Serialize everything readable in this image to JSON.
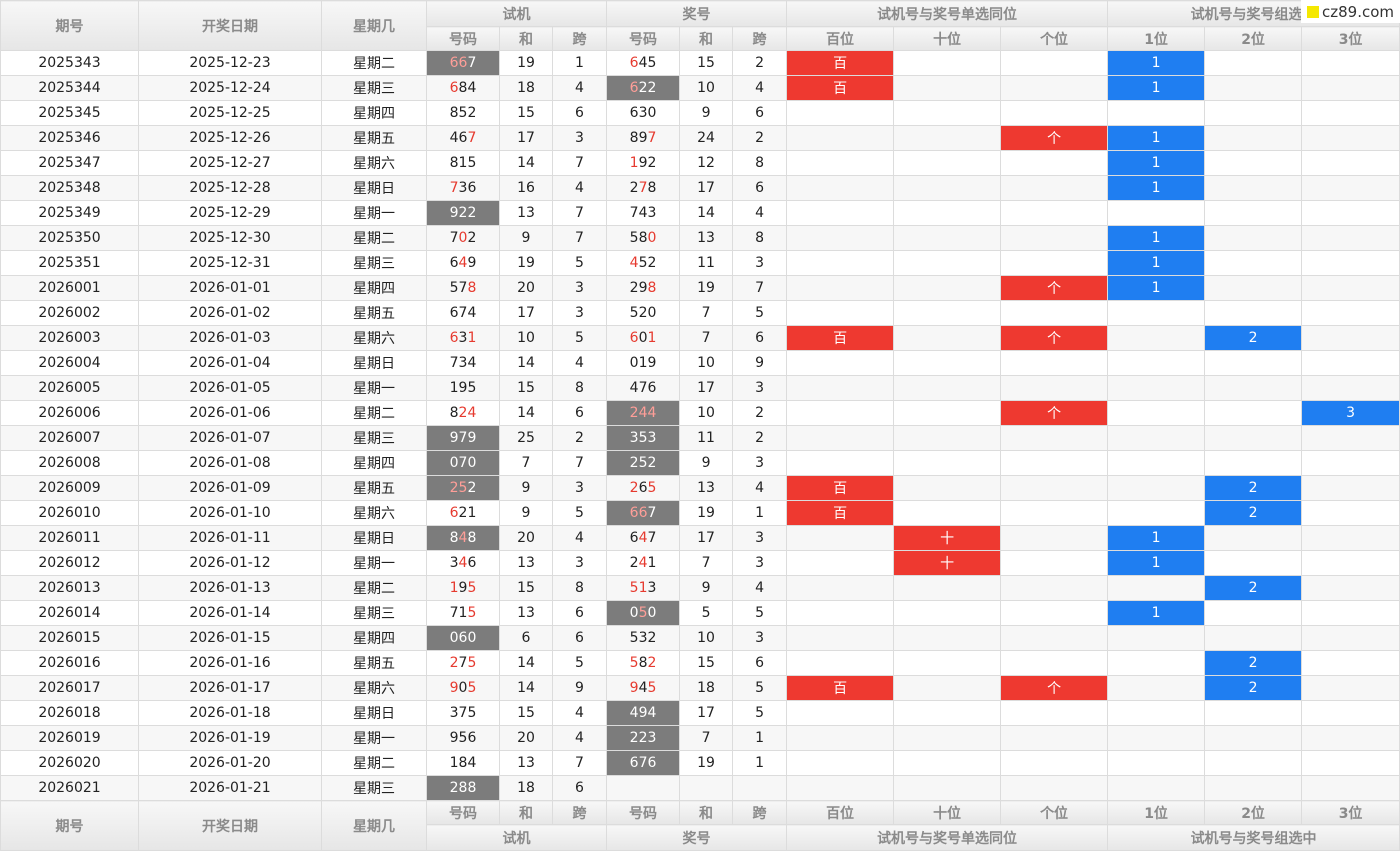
{
  "logo": {
    "text": "cz89.com",
    "icon": "yellow-square-icon"
  },
  "headers": {
    "period": "期号",
    "date": "开奖日期",
    "weekday": "星期几",
    "trial": "试机",
    "prize": "奖号",
    "single_same": "试机号与奖号单选同位",
    "group_same": "试机号与奖号组选中",
    "code": "号码",
    "sum": "和",
    "span": "跨",
    "bai": "百位",
    "shi": "十位",
    "ge": "个位",
    "pos1": "1位",
    "pos2": "2位",
    "pos3": "3位"
  },
  "colors": {
    "red_mark": "#ee3930",
    "blue_mark": "#1f7ef1",
    "dark_cell": "#7c7c7c",
    "digit_red": "#e63a2f"
  },
  "rows": [
    {
      "period": "2025343",
      "date": "2025-12-23",
      "weekday": "星期二",
      "trial": "667",
      "trial_hi": [
        0,
        1
      ],
      "trial_dark": true,
      "tsum": "19",
      "tspan": "1",
      "prize": "645",
      "prize_hi": [
        0
      ],
      "prize_dark": false,
      "psum": "15",
      "pspan": "2",
      "bai": "百",
      "shi": "",
      "ge": "",
      "p1": "1",
      "p2": "",
      "p3": ""
    },
    {
      "period": "2025344",
      "date": "2025-12-24",
      "weekday": "星期三",
      "trial": "684",
      "trial_hi": [
        0
      ],
      "trial_dark": false,
      "tsum": "18",
      "tspan": "4",
      "prize": "622",
      "prize_hi": [
        0
      ],
      "prize_dark": true,
      "psum": "10",
      "pspan": "4",
      "bai": "百",
      "shi": "",
      "ge": "",
      "p1": "1",
      "p2": "",
      "p3": ""
    },
    {
      "period": "2025345",
      "date": "2025-12-25",
      "weekday": "星期四",
      "trial": "852",
      "trial_hi": [],
      "trial_dark": false,
      "tsum": "15",
      "tspan": "6",
      "prize": "630",
      "prize_hi": [],
      "prize_dark": false,
      "psum": "9",
      "pspan": "6",
      "bai": "",
      "shi": "",
      "ge": "",
      "p1": "",
      "p2": "",
      "p3": ""
    },
    {
      "period": "2025346",
      "date": "2025-12-26",
      "weekday": "星期五",
      "trial": "467",
      "trial_hi": [
        2
      ],
      "trial_dark": false,
      "tsum": "17",
      "tspan": "3",
      "prize": "897",
      "prize_hi": [
        2
      ],
      "prize_dark": false,
      "psum": "24",
      "pspan": "2",
      "bai": "",
      "shi": "",
      "ge": "个",
      "p1": "1",
      "p2": "",
      "p3": ""
    },
    {
      "period": "2025347",
      "date": "2025-12-27",
      "weekday": "星期六",
      "trial": "815",
      "trial_hi": [],
      "trial_dark": false,
      "tsum": "14",
      "tspan": "7",
      "prize": "192",
      "prize_hi": [
        0
      ],
      "prize_dark": false,
      "psum": "12",
      "pspan": "8",
      "bai": "",
      "shi": "",
      "ge": "",
      "p1": "1",
      "p2": "",
      "p3": ""
    },
    {
      "period": "2025348",
      "date": "2025-12-28",
      "weekday": "星期日",
      "trial": "736",
      "trial_hi": [
        0
      ],
      "trial_dark": false,
      "tsum": "16",
      "tspan": "4",
      "prize": "278",
      "prize_hi": [
        1
      ],
      "prize_dark": false,
      "psum": "17",
      "pspan": "6",
      "bai": "",
      "shi": "",
      "ge": "",
      "p1": "1",
      "p2": "",
      "p3": ""
    },
    {
      "period": "2025349",
      "date": "2025-12-29",
      "weekday": "星期一",
      "trial": "922",
      "trial_hi": [],
      "trial_dark": true,
      "tsum": "13",
      "tspan": "7",
      "prize": "743",
      "prize_hi": [],
      "prize_dark": false,
      "psum": "14",
      "pspan": "4",
      "bai": "",
      "shi": "",
      "ge": "",
      "p1": "",
      "p2": "",
      "p3": ""
    },
    {
      "period": "2025350",
      "date": "2025-12-30",
      "weekday": "星期二",
      "trial": "702",
      "trial_hi": [
        1
      ],
      "trial_dark": false,
      "tsum": "9",
      "tspan": "7",
      "prize": "580",
      "prize_hi": [
        2
      ],
      "prize_dark": false,
      "psum": "13",
      "pspan": "8",
      "bai": "",
      "shi": "",
      "ge": "",
      "p1": "1",
      "p2": "",
      "p3": ""
    },
    {
      "period": "2025351",
      "date": "2025-12-31",
      "weekday": "星期三",
      "trial": "649",
      "trial_hi": [
        1
      ],
      "trial_dark": false,
      "tsum": "19",
      "tspan": "5",
      "prize": "452",
      "prize_hi": [
        0
      ],
      "prize_dark": false,
      "psum": "11",
      "pspan": "3",
      "bai": "",
      "shi": "",
      "ge": "",
      "p1": "1",
      "p2": "",
      "p3": ""
    },
    {
      "period": "2026001",
      "date": "2026-01-01",
      "weekday": "星期四",
      "trial": "578",
      "trial_hi": [
        2
      ],
      "trial_dark": false,
      "tsum": "20",
      "tspan": "3",
      "prize": "298",
      "prize_hi": [
        2
      ],
      "prize_dark": false,
      "psum": "19",
      "pspan": "7",
      "bai": "",
      "shi": "",
      "ge": "个",
      "p1": "1",
      "p2": "",
      "p3": ""
    },
    {
      "period": "2026002",
      "date": "2026-01-02",
      "weekday": "星期五",
      "trial": "674",
      "trial_hi": [],
      "trial_dark": false,
      "tsum": "17",
      "tspan": "3",
      "prize": "520",
      "prize_hi": [],
      "prize_dark": false,
      "psum": "7",
      "pspan": "5",
      "bai": "",
      "shi": "",
      "ge": "",
      "p1": "",
      "p2": "",
      "p3": ""
    },
    {
      "period": "2026003",
      "date": "2026-01-03",
      "weekday": "星期六",
      "trial": "631",
      "trial_hi": [
        0,
        2
      ],
      "trial_dark": false,
      "tsum": "10",
      "tspan": "5",
      "prize": "601",
      "prize_hi": [
        0,
        2
      ],
      "prize_dark": false,
      "psum": "7",
      "pspan": "6",
      "bai": "百",
      "shi": "",
      "ge": "个",
      "p1": "",
      "p2": "2",
      "p3": ""
    },
    {
      "period": "2026004",
      "date": "2026-01-04",
      "weekday": "星期日",
      "trial": "734",
      "trial_hi": [],
      "trial_dark": false,
      "tsum": "14",
      "tspan": "4",
      "prize": "019",
      "prize_hi": [],
      "prize_dark": false,
      "psum": "10",
      "pspan": "9",
      "bai": "",
      "shi": "",
      "ge": "",
      "p1": "",
      "p2": "",
      "p3": ""
    },
    {
      "period": "2026005",
      "date": "2026-01-05",
      "weekday": "星期一",
      "trial": "195",
      "trial_hi": [],
      "trial_dark": false,
      "tsum": "15",
      "tspan": "8",
      "prize": "476",
      "prize_hi": [],
      "prize_dark": false,
      "psum": "17",
      "pspan": "3",
      "bai": "",
      "shi": "",
      "ge": "",
      "p1": "",
      "p2": "",
      "p3": ""
    },
    {
      "period": "2026006",
      "date": "2026-01-06",
      "weekday": "星期二",
      "trial": "824",
      "trial_hi": [
        1,
        2
      ],
      "trial_dark": false,
      "tsum": "14",
      "tspan": "6",
      "prize": "244",
      "prize_hi": [
        0,
        1,
        2
      ],
      "prize_dark": true,
      "psum": "10",
      "pspan": "2",
      "bai": "",
      "shi": "",
      "ge": "个",
      "p1": "",
      "p2": "",
      "p3": "3"
    },
    {
      "period": "2026007",
      "date": "2026-01-07",
      "weekday": "星期三",
      "trial": "979",
      "trial_hi": [],
      "trial_dark": true,
      "tsum": "25",
      "tspan": "2",
      "prize": "353",
      "prize_hi": [],
      "prize_dark": true,
      "psum": "11",
      "pspan": "2",
      "bai": "",
      "shi": "",
      "ge": "",
      "p1": "",
      "p2": "",
      "p3": ""
    },
    {
      "period": "2026008",
      "date": "2026-01-08",
      "weekday": "星期四",
      "trial": "070",
      "trial_hi": [],
      "trial_dark": true,
      "tsum": "7",
      "tspan": "7",
      "prize": "252",
      "prize_hi": [],
      "prize_dark": true,
      "psum": "9",
      "pspan": "3",
      "bai": "",
      "shi": "",
      "ge": "",
      "p1": "",
      "p2": "",
      "p3": ""
    },
    {
      "period": "2026009",
      "date": "2026-01-09",
      "weekday": "星期五",
      "trial": "252",
      "trial_hi": [
        0,
        1
      ],
      "trial_dark": true,
      "tsum": "9",
      "tspan": "3",
      "prize": "265",
      "prize_hi": [
        0,
        2
      ],
      "prize_dark": false,
      "psum": "13",
      "pspan": "4",
      "bai": "百",
      "shi": "",
      "ge": "",
      "p1": "",
      "p2": "2",
      "p3": ""
    },
    {
      "period": "2026010",
      "date": "2026-01-10",
      "weekday": "星期六",
      "trial": "621",
      "trial_hi": [
        0
      ],
      "trial_dark": false,
      "tsum": "9",
      "tspan": "5",
      "prize": "667",
      "prize_hi": [
        0,
        1
      ],
      "prize_dark": true,
      "psum": "19",
      "pspan": "1",
      "bai": "百",
      "shi": "",
      "ge": "",
      "p1": "",
      "p2": "2",
      "p3": ""
    },
    {
      "period": "2026011",
      "date": "2026-01-11",
      "weekday": "星期日",
      "trial": "848",
      "trial_hi": [
        1
      ],
      "trial_dark": true,
      "tsum": "20",
      "tspan": "4",
      "prize": "647",
      "prize_hi": [
        1
      ],
      "prize_dark": false,
      "psum": "17",
      "pspan": "3",
      "bai": "",
      "shi": "十",
      "ge": "",
      "p1": "1",
      "p2": "",
      "p3": ""
    },
    {
      "period": "2026012",
      "date": "2026-01-12",
      "weekday": "星期一",
      "trial": "346",
      "trial_hi": [
        1
      ],
      "trial_dark": false,
      "tsum": "13",
      "tspan": "3",
      "prize": "241",
      "prize_hi": [
        1
      ],
      "prize_dark": false,
      "psum": "7",
      "pspan": "3",
      "bai": "",
      "shi": "十",
      "ge": "",
      "p1": "1",
      "p2": "",
      "p3": ""
    },
    {
      "period": "2026013",
      "date": "2026-01-13",
      "weekday": "星期二",
      "trial": "195",
      "trial_hi": [
        0,
        2
      ],
      "trial_dark": false,
      "tsum": "15",
      "tspan": "8",
      "prize": "513",
      "prize_hi": [
        0,
        1
      ],
      "prize_dark": false,
      "psum": "9",
      "pspan": "4",
      "bai": "",
      "shi": "",
      "ge": "",
      "p1": "",
      "p2": "2",
      "p3": ""
    },
    {
      "period": "2026014",
      "date": "2026-01-14",
      "weekday": "星期三",
      "trial": "715",
      "trial_hi": [
        2
      ],
      "trial_dark": false,
      "tsum": "13",
      "tspan": "6",
      "prize": "050",
      "prize_hi": [
        1
      ],
      "prize_dark": true,
      "psum": "5",
      "pspan": "5",
      "bai": "",
      "shi": "",
      "ge": "",
      "p1": "1",
      "p2": "",
      "p3": ""
    },
    {
      "period": "2026015",
      "date": "2026-01-15",
      "weekday": "星期四",
      "trial": "060",
      "trial_hi": [],
      "trial_dark": true,
      "tsum": "6",
      "tspan": "6",
      "prize": "532",
      "prize_hi": [],
      "prize_dark": false,
      "psum": "10",
      "pspan": "3",
      "bai": "",
      "shi": "",
      "ge": "",
      "p1": "",
      "p2": "",
      "p3": ""
    },
    {
      "period": "2026016",
      "date": "2026-01-16",
      "weekday": "星期五",
      "trial": "275",
      "trial_hi": [
        0,
        2
      ],
      "trial_dark": false,
      "tsum": "14",
      "tspan": "5",
      "prize": "582",
      "prize_hi": [
        0,
        2
      ],
      "prize_dark": false,
      "psum": "15",
      "pspan": "6",
      "bai": "",
      "shi": "",
      "ge": "",
      "p1": "",
      "p2": "2",
      "p3": ""
    },
    {
      "period": "2026017",
      "date": "2026-01-17",
      "weekday": "星期六",
      "trial": "905",
      "trial_hi": [
        0,
        2
      ],
      "trial_dark": false,
      "tsum": "14",
      "tspan": "9",
      "prize": "945",
      "prize_hi": [
        0,
        2
      ],
      "prize_dark": false,
      "psum": "18",
      "pspan": "5",
      "bai": "百",
      "shi": "",
      "ge": "个",
      "p1": "",
      "p2": "2",
      "p3": ""
    },
    {
      "period": "2026018",
      "date": "2026-01-18",
      "weekday": "星期日",
      "trial": "375",
      "trial_hi": [],
      "trial_dark": false,
      "tsum": "15",
      "tspan": "4",
      "prize": "494",
      "prize_hi": [],
      "prize_dark": true,
      "psum": "17",
      "pspan": "5",
      "bai": "",
      "shi": "",
      "ge": "",
      "p1": "",
      "p2": "",
      "p3": ""
    },
    {
      "period": "2026019",
      "date": "2026-01-19",
      "weekday": "星期一",
      "trial": "956",
      "trial_hi": [],
      "trial_dark": false,
      "tsum": "20",
      "tspan": "4",
      "prize": "223",
      "prize_hi": [],
      "prize_dark": true,
      "psum": "7",
      "pspan": "1",
      "bai": "",
      "shi": "",
      "ge": "",
      "p1": "",
      "p2": "",
      "p3": ""
    },
    {
      "period": "2026020",
      "date": "2026-01-20",
      "weekday": "星期二",
      "trial": "184",
      "trial_hi": [],
      "trial_dark": false,
      "tsum": "13",
      "tspan": "7",
      "prize": "676",
      "prize_hi": [],
      "prize_dark": true,
      "psum": "19",
      "pspan": "1",
      "bai": "",
      "shi": "",
      "ge": "",
      "p1": "",
      "p2": "",
      "p3": ""
    },
    {
      "period": "2026021",
      "date": "2026-01-21",
      "weekday": "星期三",
      "trial": "288",
      "trial_hi": [],
      "trial_dark": true,
      "tsum": "18",
      "tspan": "6",
      "prize": "",
      "prize_hi": [],
      "prize_dark": false,
      "psum": "",
      "pspan": "",
      "bai": "",
      "shi": "",
      "ge": "",
      "p1": "",
      "p2": "",
      "p3": ""
    }
  ]
}
